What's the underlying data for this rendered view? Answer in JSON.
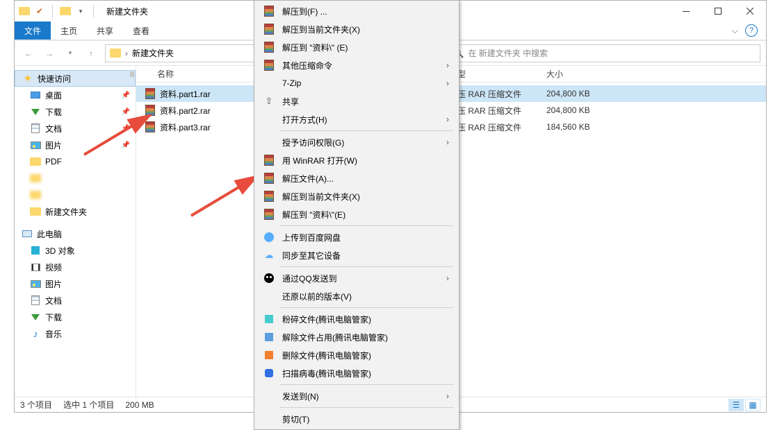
{
  "window": {
    "title": "新建文件夹",
    "tabs": {
      "file": "文件",
      "home": "主页",
      "share": "共享",
      "view": "查看"
    }
  },
  "address": {
    "crumb": "新建文件夹",
    "search_placeholder": "在 新建文件夹 中搜索"
  },
  "sidebar": {
    "quick": "快速访问",
    "desktop": "桌面",
    "downloads": "下载",
    "documents": "文档",
    "pictures": "图片",
    "pdf": "PDF",
    "newfolder": "新建文件夹",
    "thispc": "此电脑",
    "obj3d": "3D 对象",
    "video": "视频",
    "pictures2": "图片",
    "documents2": "文档",
    "downloads2": "下载",
    "music": "音乐"
  },
  "columns": {
    "name": "名称",
    "type": "类型",
    "size": "大小"
  },
  "files": [
    {
      "name": "资料.part1.rar",
      "type": "好压 RAR 压缩文件",
      "size": "204,800 KB",
      "selected": true
    },
    {
      "name": "资料.part2.rar",
      "type": "好压 RAR 压缩文件",
      "size": "204,800 KB",
      "selected": false
    },
    {
      "name": "资料.part3.rar",
      "type": "好压 RAR 压缩文件",
      "size": "184,560 KB",
      "selected": false
    }
  ],
  "statusbar": {
    "count": "3 个项目",
    "selected": "选中 1 个项目",
    "size": "200 MB"
  },
  "menu": {
    "extractTo": "解压到(F) ...",
    "extractHere": "解压到当前文件夹(X)",
    "extractFolder": "解压到 \"资料\\\" (E)",
    "otherCompress": "其他压缩命令",
    "sevenZip": "7-Zip",
    "share": "共享",
    "openWith": "打开方式(H)",
    "giveAccess": "授予访问权限(G)",
    "openWinrar": "用 WinRAR 打开(W)",
    "extractA": "解压文件(A)...",
    "extractHere2": "解压到当前文件夹(X)",
    "extractFolder2": "解压到 \"资料\\\"(E)",
    "uploadBaidu": "上传到百度网盘",
    "syncDevice": "同步至其它设备",
    "sendQQ": "通过QQ发送到",
    "restore": "还原以前的版本(V)",
    "smash": "粉碎文件(腾讯电脑管家)",
    "unlock": "解除文件占用(腾讯电脑管家)",
    "delete": "删除文件(腾讯电脑管家)",
    "scan": "扫描病毒(腾讯电脑管家)",
    "sendTo": "发送到(N)",
    "cut": "剪切(T)"
  }
}
